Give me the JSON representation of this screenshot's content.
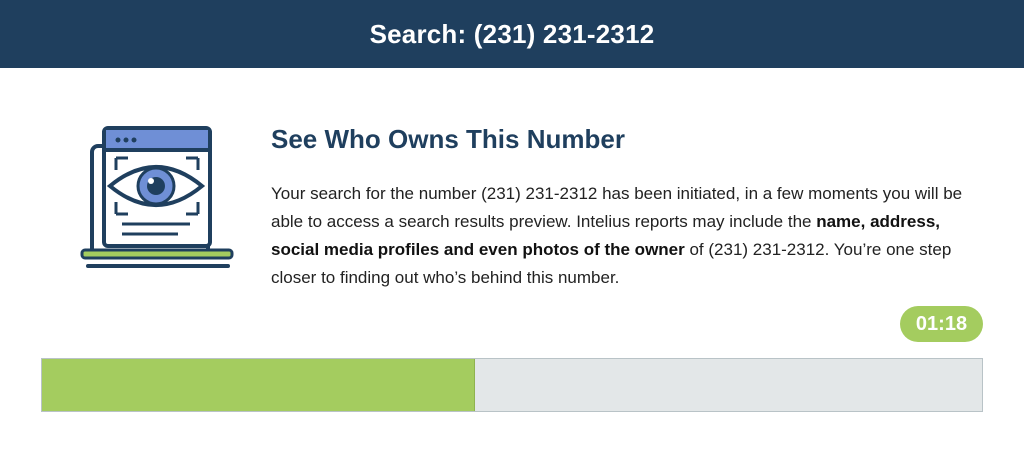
{
  "header": {
    "title": "Search: (231) 231-2312"
  },
  "main": {
    "title": "See Who Owns This Number",
    "description": {
      "part1": "Your search for the number (231) 231-2312 has been initiated, in a few moments you will be able to access a search results preview. Intelius reports may include the ",
      "bold": "name, address, social media profiles and even photos of the owner",
      "part2": " of (231) 231-2312. You’re one step closer to finding out who’s behind this number."
    },
    "illustration_icon": "laptop-eye-icon"
  },
  "timer": {
    "value": "01:18"
  },
  "progress": {
    "fraction": 0.46
  },
  "colors": {
    "header_bg": "#1f3f5e",
    "accent_green": "#a4cc5f",
    "track_gray": "#e3e7e8",
    "eye_blue": "#6f8fd6"
  }
}
